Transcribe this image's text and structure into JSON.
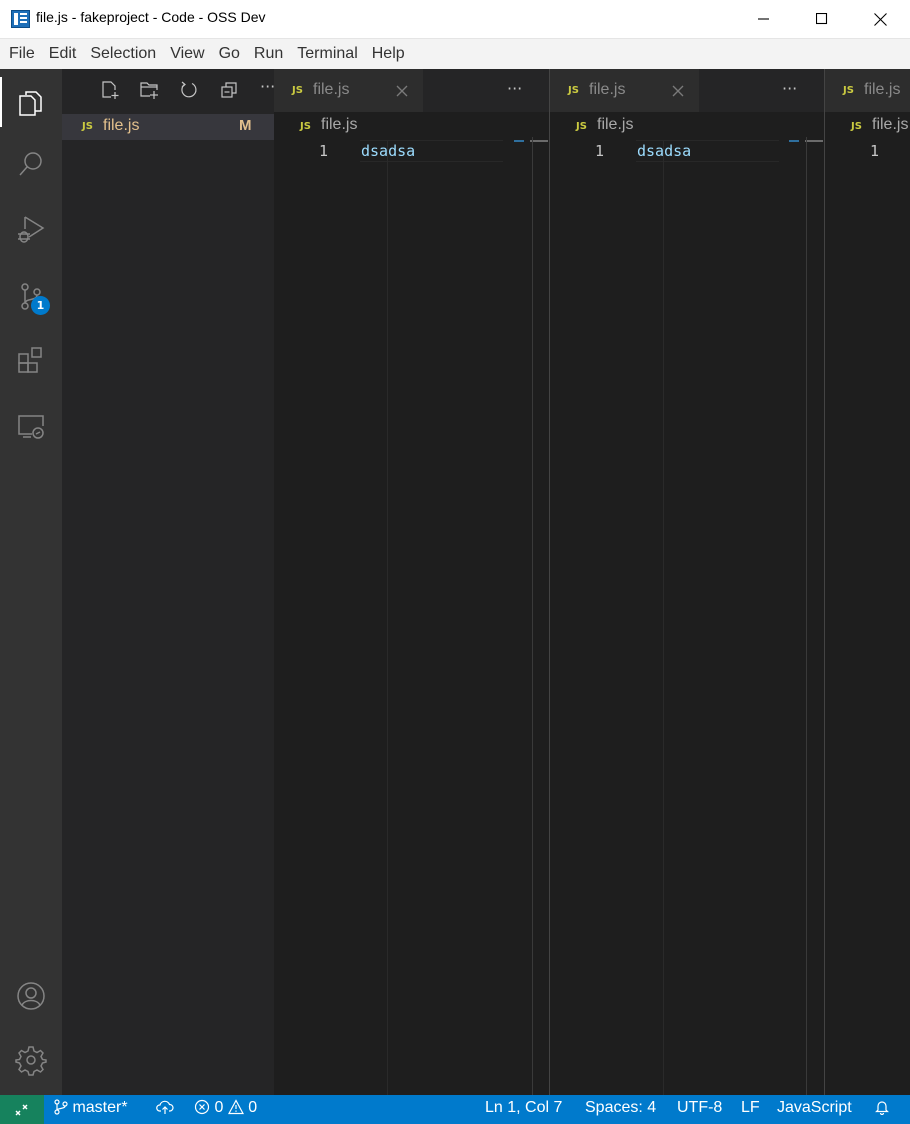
{
  "window": {
    "title": "file.js - fakeproject - Code - OSS Dev"
  },
  "menu": [
    "File",
    "Edit",
    "Selection",
    "View",
    "Go",
    "Run",
    "Terminal",
    "Help"
  ],
  "activity_bar": {
    "scm_badge": "1",
    "items": [
      "explorer-icon",
      "search-icon",
      "run-debug-icon",
      "source-control-icon",
      "extensions-icon",
      "remote-explorer-icon",
      "accounts-icon",
      "manage-gear-icon"
    ]
  },
  "explorer": {
    "more": "···",
    "file": {
      "icon_text": "JS",
      "name": "file.js",
      "status": "M"
    }
  },
  "editor_groups": [
    {
      "tab": {
        "icon_text": "JS",
        "label": "file.js",
        "close": "×"
      },
      "more": "···",
      "breadcrumb": {
        "icon_text": "JS",
        "label": "file.js"
      },
      "line_number": "1",
      "code": "dsadsa"
    },
    {
      "tab": {
        "icon_text": "JS",
        "label": "file.js",
        "close": "×"
      },
      "more": "···",
      "breadcrumb": {
        "icon_text": "JS",
        "label": "file.js"
      },
      "line_number": "1",
      "code": "dsadsa"
    },
    {
      "tab": {
        "icon_text": "JS",
        "label": "file.js"
      },
      "breadcrumb": {
        "icon_text": "JS",
        "label": "file.js"
      },
      "line_number": "1"
    }
  ],
  "status_bar": {
    "branch": "master*",
    "errors": "0",
    "warnings": "0",
    "position": "Ln 1, Col 7",
    "spaces": "Spaces: 4",
    "encoding": "UTF-8",
    "eol": "LF",
    "language": "JavaScript"
  },
  "colors": {
    "status_bar": "#007acc",
    "remote": "#16825d",
    "activity_bar": "#333333",
    "sidebar": "#252526",
    "editor": "#1e1e1e",
    "modified": "#e2c08d",
    "js_icon": "#cbcb41"
  }
}
